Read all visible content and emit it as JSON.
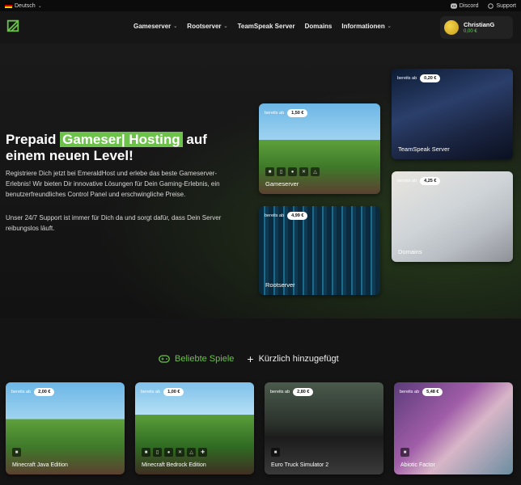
{
  "topbar": {
    "language": "Deutsch",
    "links": [
      "Discord",
      "Support"
    ]
  },
  "nav": {
    "menu": [
      "Gameserver",
      "Rootserver",
      "TeamSpeak Server",
      "Domains",
      "Informationen"
    ],
    "user": {
      "name": "ChristianG",
      "balance": "0,00 €"
    }
  },
  "hero": {
    "title_pre": "Prepaid",
    "title_highlight": "Gameser| Hosting",
    "title_post": "auf",
    "title_line2": "einem neuen Level!",
    "p1": "Registriere Dich jetzt bei EmeraldHost und erlebe das beste Gameserver-Erlebnis! Wir bieten Dir innovative Lösungen für Dein Gaming-Erlebnis, ein benutzerfreundliches Control Panel und erschwingliche Preise.",
    "p2": "Unser 24/7 Support ist immer für Dich da und sorgt dafür, dass Dein Server reibungslos läuft."
  },
  "price_prefix": "bereits ab",
  "hero_cards": [
    {
      "label": "Gameserver",
      "price": "1,50 €"
    },
    {
      "label": "Rootserver",
      "price": "4,99 €"
    },
    {
      "label": "TeamSpeak Server",
      "price": "0,20 €"
    },
    {
      "label": "Domains",
      "price": "4,25 €"
    }
  ],
  "tabs": [
    "Beliebte Spiele",
    "Kürzlich hinzugefügt"
  ],
  "games": [
    {
      "label": "Minecraft Java Edition",
      "price": "2,00 €"
    },
    {
      "label": "Minecraft Bedrock Edition",
      "price": "1,00 €"
    },
    {
      "label": "Euro Truck Simulator 2",
      "price": "2,80 €"
    },
    {
      "label": "Abiotic Factor",
      "price": "5,48 €"
    }
  ],
  "colors": {
    "accent": "#6cc24a",
    "background": "#141414"
  }
}
